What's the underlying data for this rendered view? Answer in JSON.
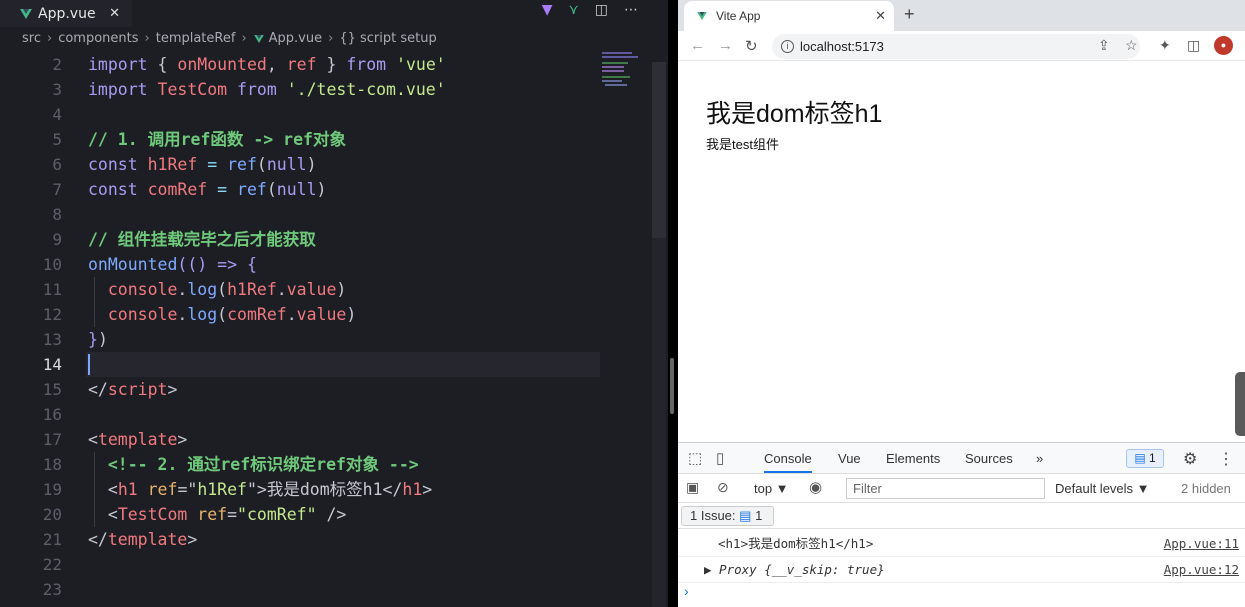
{
  "editor": {
    "tab_title": "App.vue",
    "breadcrumb": [
      "src",
      "components",
      "templateRef",
      "App.vue",
      "{} script setup"
    ],
    "lines": [
      {
        "n": "2",
        "tokens": [
          [
            "kw",
            "import"
          ],
          [
            "pl",
            " { "
          ],
          [
            "id",
            "onMounted"
          ],
          [
            "pl",
            ", "
          ],
          [
            "id",
            "ref"
          ],
          [
            "pl",
            " } "
          ],
          [
            "kw",
            "from"
          ],
          [
            "pl",
            " "
          ],
          [
            "str",
            "'vue'"
          ]
        ]
      },
      {
        "n": "3",
        "tokens": [
          [
            "kw",
            "import"
          ],
          [
            "pl",
            " "
          ],
          [
            "id",
            "TestCom"
          ],
          [
            "pl",
            " "
          ],
          [
            "kw",
            "from"
          ],
          [
            "pl",
            " "
          ],
          [
            "str",
            "'./test-com.vue'"
          ]
        ]
      },
      {
        "n": "4",
        "tokens": []
      },
      {
        "n": "5",
        "tokens": [
          [
            "cm",
            "// 1. 调用ref函数 -> ref对象"
          ]
        ]
      },
      {
        "n": "6",
        "tokens": [
          [
            "kw",
            "const"
          ],
          [
            "pl",
            " "
          ],
          [
            "id",
            "h1Ref"
          ],
          [
            "pl",
            " "
          ],
          [
            "pu",
            "="
          ],
          [
            "pl",
            " "
          ],
          [
            "fn",
            "ref"
          ],
          [
            "pl",
            "("
          ],
          [
            "kw",
            "null"
          ],
          [
            "pl",
            ")"
          ]
        ]
      },
      {
        "n": "7",
        "tokens": [
          [
            "kw",
            "const"
          ],
          [
            "pl",
            " "
          ],
          [
            "id",
            "comRef"
          ],
          [
            "pl",
            " "
          ],
          [
            "pu",
            "="
          ],
          [
            "pl",
            " "
          ],
          [
            "fn",
            "ref"
          ],
          [
            "pl",
            "("
          ],
          [
            "kw",
            "null"
          ],
          [
            "pl",
            ")"
          ]
        ]
      },
      {
        "n": "8",
        "tokens": []
      },
      {
        "n": "9",
        "tokens": [
          [
            "cm",
            "// 组件挂载完毕之后才能获取"
          ]
        ]
      },
      {
        "n": "10",
        "tokens": [
          [
            "fn",
            "onMounted"
          ],
          [
            "kw",
            "(("
          ],
          [
            "kw",
            ")"
          ],
          [
            "pl",
            " "
          ],
          [
            "kw",
            "=>"
          ],
          [
            "pl",
            " "
          ],
          [
            "kw",
            "{"
          ]
        ]
      },
      {
        "n": "11",
        "tokens": [
          [
            "pl",
            "  "
          ],
          [
            "id",
            "console"
          ],
          [
            "pl",
            "."
          ],
          [
            "fn",
            "log"
          ],
          [
            "pl",
            "("
          ],
          [
            "id",
            "h1Ref"
          ],
          [
            "pl",
            "."
          ],
          [
            "id",
            "value"
          ],
          [
            "pl",
            ")"
          ]
        ]
      },
      {
        "n": "12",
        "tokens": [
          [
            "pl",
            "  "
          ],
          [
            "id",
            "console"
          ],
          [
            "pl",
            "."
          ],
          [
            "fn",
            "log"
          ],
          [
            "pl",
            "("
          ],
          [
            "id",
            "comRef"
          ],
          [
            "pl",
            "."
          ],
          [
            "id",
            "value"
          ],
          [
            "pl",
            ")"
          ]
        ]
      },
      {
        "n": "13",
        "tokens": [
          [
            "kw",
            "}"
          ],
          [
            "pl",
            ")"
          ]
        ]
      },
      {
        "n": "14",
        "tokens": [],
        "active": true
      },
      {
        "n": "15",
        "tokens": [
          [
            "pl",
            "</"
          ],
          [
            "tag",
            "script"
          ],
          [
            "pl",
            ">"
          ]
        ]
      },
      {
        "n": "16",
        "tokens": []
      },
      {
        "n": "17",
        "tokens": [
          [
            "pl",
            "<"
          ],
          [
            "tag",
            "template"
          ],
          [
            "pl",
            ">"
          ]
        ]
      },
      {
        "n": "18",
        "tokens": [
          [
            "pl",
            "  "
          ],
          [
            "cm",
            "<!-- 2. 通过ref标识绑定ref对象 -->"
          ]
        ]
      },
      {
        "n": "19",
        "tokens": [
          [
            "pl",
            "  <"
          ],
          [
            "tag",
            "h1"
          ],
          [
            "pl",
            " "
          ],
          [
            "attr",
            "ref"
          ],
          [
            "pl",
            "=\""
          ],
          [
            "str",
            "h1Ref"
          ],
          [
            "pl",
            "\">我是dom标签h1</"
          ],
          [
            "tag",
            "h1"
          ],
          [
            "pl",
            ">"
          ]
        ]
      },
      {
        "n": "20",
        "tokens": [
          [
            "pl",
            "  <"
          ],
          [
            "tag",
            "TestCom"
          ],
          [
            "pl",
            " "
          ],
          [
            "attr",
            "ref"
          ],
          [
            "pl",
            "="
          ],
          [
            "str",
            "\"comRef\""
          ],
          [
            "pl",
            " />"
          ]
        ]
      },
      {
        "n": "21",
        "tokens": [
          [
            "pl",
            "</"
          ],
          [
            "tag",
            "template"
          ],
          [
            "pl",
            ">"
          ]
        ]
      },
      {
        "n": "22",
        "tokens": []
      },
      {
        "n": "23",
        "tokens": []
      }
    ]
  },
  "browser": {
    "tab_title": "Vite App",
    "url": "localhost:5173",
    "page": {
      "heading": "我是dom标签h1",
      "component_text": "我是test组件"
    }
  },
  "devtools": {
    "tabs": [
      "Console",
      "Vue",
      "Elements",
      "Sources",
      "»"
    ],
    "issue_badge": "1",
    "context": "top ▼",
    "filter_placeholder": "Filter",
    "levels": "Default levels ▼",
    "hidden": "2 hidden",
    "issues_label": "1 Issue:",
    "issues_count": "1",
    "logs": [
      {
        "text": "<h1>我是dom标签h1</h1>",
        "source": "App.vue:11"
      },
      {
        "text": "▶ Proxy {__v_skip: true}",
        "source": "App.vue:12"
      }
    ],
    "prompt": "›"
  }
}
